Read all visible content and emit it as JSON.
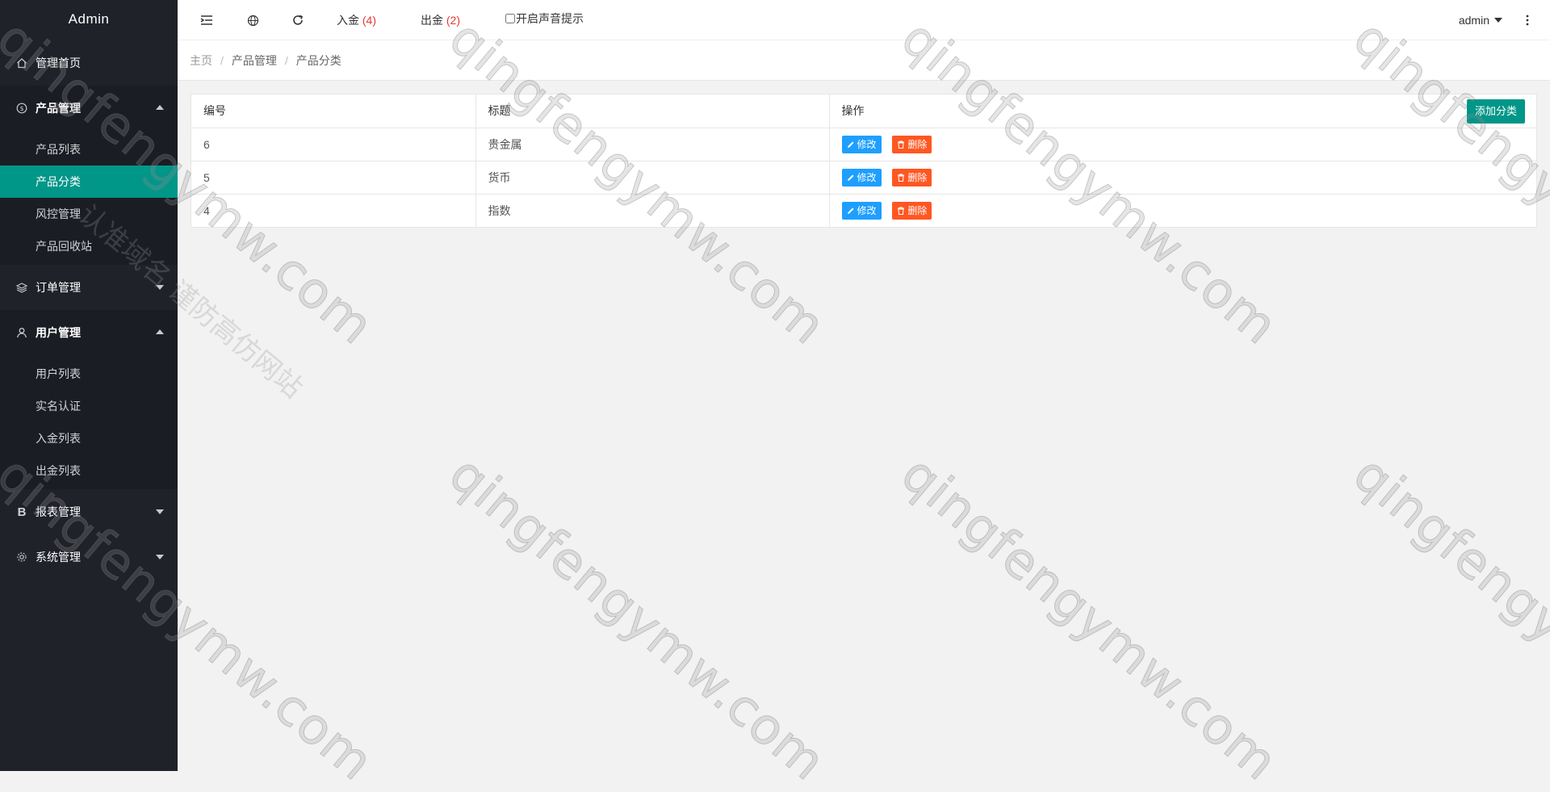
{
  "sidebar": {
    "title": "Admin",
    "home": "管理首页",
    "product_menu": {
      "label": "产品管理",
      "items": [
        "产品列表",
        "产品分类",
        "风控管理",
        "产品回收站"
      ]
    },
    "order_menu": "订单管理",
    "user_menu": {
      "label": "用户管理",
      "items": [
        "用户列表",
        "实名认证",
        "入金列表",
        "出金列表"
      ]
    },
    "report_menu": "报表管理",
    "system_menu": "系统管理"
  },
  "header": {
    "deposit_label": "入金",
    "deposit_count": "(4)",
    "withdraw_label": "出金",
    "withdraw_count": "(2)",
    "sound_label": "开启声音提示",
    "user": "admin"
  },
  "breadcrumb": [
    "主页",
    "产品管理",
    "产品分类"
  ],
  "table": {
    "headers": [
      "编号",
      "标题",
      "操作"
    ],
    "add_label": "添加分类",
    "edit_label": "修改",
    "delete_label": "删除",
    "rows": [
      {
        "id": "6",
        "title": "贵金属"
      },
      {
        "id": "5",
        "title": "货币"
      },
      {
        "id": "4",
        "title": "指数"
      }
    ]
  },
  "watermark": {
    "text": "qingfengymw.com",
    "cn_text": "认准域名 谨防高仿网站"
  },
  "colors": {
    "sidebar_bg": "#20222a",
    "active": "#009688",
    "edit_btn": "#1e9fff",
    "delete_btn": "#ff5722",
    "count": "#e53935"
  }
}
